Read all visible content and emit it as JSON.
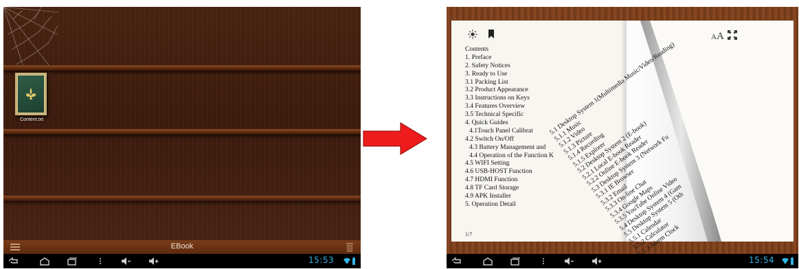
{
  "left_screen": {
    "book": {
      "caption": "Content.txt"
    },
    "bottombar": {
      "title": "EBook"
    },
    "navbar": {
      "clock": "15:53"
    }
  },
  "right_screen": {
    "reader": {
      "font_size_label_small": "A",
      "font_size_label_big": "A",
      "toc": [
        "Contents",
        "1. Preface",
        "2. Safety Notices",
        "3. Ready to Use",
        "3.1 Packing List",
        "3.2 Product Appearance",
        "3.3 Instructions on Keys",
        "3.4 Features Overview",
        "3.5 Technical Specific",
        "4. Quick Guides",
        "4.1Touch Panel Calibrat",
        "4.2 Switch On/Off",
        "4.3 Battery Management and",
        "4.4 Operation of the Function K",
        "4.5 WIFI Setting",
        "4.6 USB-HOST Function",
        "4.7 HDMI Function",
        "4.8 TF Card Storage",
        "4.9 APK Installer",
        "5. Operation Detail"
      ],
      "toc_indented": [
        10,
        12,
        13
      ],
      "curled_page_toc": [
        "5.1 Desktop System 1(Multimedia Music/Video/Reading)",
        "5.1.1 Music",
        "5.1.2 Video",
        "5.1.3 Picture",
        "5.1.4 Recording",
        "5.1.5 Explorer",
        "5.2 Desktop System 2 (E-book)",
        "5.2.1 Local E-book Reader",
        "5.2.2 Online E-book Reader",
        "5.3 Desktop System 3 (Network Fu",
        "5.3.1 IE Browser",
        "5.3.2 Email",
        "5.3.3 On-line Chat",
        "5.3.4 Google Maps",
        "5.3.5 YouTube Online Video",
        "5.4 Desktop System 4 (Gam",
        "5.5 Desktop System 5 (Oth",
        "5.5.1 Calendar",
        "5.5.2 Calculator",
        "5.5.3 Alarm Clock"
      ],
      "page_number": "1/7"
    },
    "navbar": {
      "clock": "15:54"
    }
  },
  "colors": {
    "clock": "#33b5e5",
    "arrow": "#ee1c1c",
    "shelf_wood": "#4a2412",
    "frame_wood": "#7b3f1d"
  },
  "icons": [
    "web-icon",
    "menu-icon",
    "trash-icon",
    "back-icon",
    "home-icon",
    "recent-apps-icon",
    "menu-dots-icon",
    "volume-down-icon",
    "volume-up-icon",
    "wifi-icon",
    "battery-icon",
    "brightness-icon",
    "bookmark-icon",
    "fullscreen-icon",
    "arrow-icon"
  ]
}
